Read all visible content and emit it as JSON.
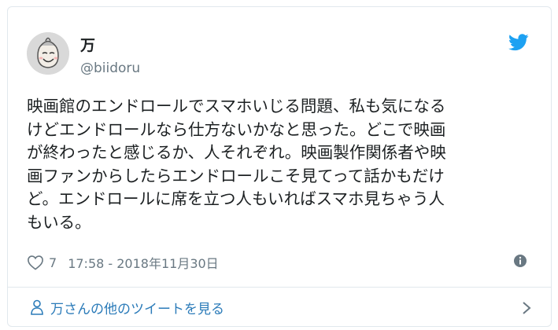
{
  "tweet": {
    "author_name": "万",
    "author_handle": "@biidoru",
    "text": "映画館のエンドロールでスマホいじる問題、私も気になる\nけどエンドロールなら仕方ないかなと思った。どこで映画\nが終わったと感じるか、人それぞれ。映画製作関係者や映\n画ファンからしたらエンドロールこそ見てって話かもだけ\nど。エンドロールに席を立つ人もいればスマホ見ちゃう人\nもいる。",
    "likes": "7",
    "timestamp": "17:58 - 2018年11月30日"
  },
  "footer": {
    "more_tweets_label": "万さんの他のツイートを見る"
  },
  "icons": {
    "brand": "twitter-bird-icon",
    "like": "heart-icon",
    "info": "info-icon",
    "person": "person-icon",
    "chevron": "chevron-right-icon"
  },
  "colors": {
    "twitter_blue": "#1da1f2",
    "link_blue": "#2b7bb9",
    "secondary_text": "#697882",
    "border": "#e1e8ed"
  }
}
